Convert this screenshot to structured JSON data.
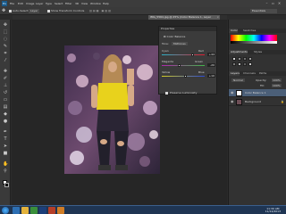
{
  "app": {
    "logo": "Ps",
    "menus": [
      "File",
      "Edit",
      "Image",
      "Layer",
      "Type",
      "Select",
      "Filter",
      "3D",
      "View",
      "Window",
      "Help"
    ],
    "essentials": "Essentials",
    "window_controls": [
      "minimize-icon",
      "restore-icon",
      "close-icon"
    ]
  },
  "options_bar": {
    "auto_select_label": "Auto-Select:",
    "auto_select_value": "Layer",
    "show_transform_label": "Show Transform Controls"
  },
  "document_tabs": [
    {
      "label": "IMG_5564.jpg @ 25% (Color Balance 1, Layer Mask/8) *",
      "active": true
    }
  ],
  "adjustment_panel": {
    "panel_title": "Properties",
    "preset_label": "Color Balance",
    "tone_label": "Tone:",
    "tone_value": "Midtones",
    "sliders": [
      {
        "left": "Cyan",
        "right": "Red",
        "value": "+44",
        "position": 0.72
      },
      {
        "left": "Magenta",
        "right": "Green",
        "value": "-20",
        "position": 0.4
      },
      {
        "left": "Yellow",
        "right": "Blue",
        "value": "+10",
        "position": 0.55
      }
    ],
    "preserve_label": "Preserve Luminosity",
    "preserve_checked": true
  },
  "panels": {
    "color_tabs": [
      "Color",
      "Swatches"
    ],
    "adjust_tabs": [
      "Adjustments",
      "Styles"
    ],
    "layers_tabs": [
      "Layers",
      "Channels",
      "Paths"
    ],
    "blend_mode": "Normal",
    "opacity_label": "Opacity:",
    "opacity_value": "100%",
    "fill_label": "Fill:",
    "fill_value": "100%",
    "layers": [
      {
        "name": "Color Balance 1",
        "type": "adjustment",
        "selected": true
      },
      {
        "name": "Background",
        "type": "photo",
        "selected": false
      }
    ]
  },
  "taskbar": {
    "time": "11:30 AM",
    "date": "11/12/2013"
  },
  "colors": {
    "ps_dark": "#2b2b2b",
    "panel": "#323232",
    "selection": "#4b5f78",
    "taskbar": "#1f3553"
  }
}
